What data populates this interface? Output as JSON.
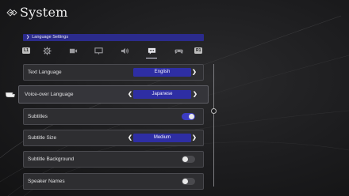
{
  "header": {
    "title": "System"
  },
  "section": {
    "label": "Language Settings"
  },
  "tabs": {
    "left_badge": "L1",
    "right_badge": "R1",
    "items": [
      {
        "icon": "gear-icon"
      },
      {
        "icon": "video-icon"
      },
      {
        "icon": "display-icon"
      },
      {
        "icon": "speaker-icon"
      },
      {
        "icon": "speech-bubble-icon",
        "active": true
      },
      {
        "icon": "gamepad-icon"
      }
    ]
  },
  "settings": {
    "text_language": {
      "label": "Text Language",
      "value": "English"
    },
    "voice_language": {
      "label": "Voice-over Language",
      "value": "Japanese"
    },
    "subtitles": {
      "label": "Subtitles",
      "state": "on"
    },
    "subtitle_size": {
      "label": "Subtitle Size",
      "value": "Medium"
    },
    "subtitle_background": {
      "label": "Subtitle Background",
      "state": "off"
    },
    "speaker_names": {
      "label": "Speaker Names",
      "state": "off"
    }
  },
  "arrows": {
    "left": "❮",
    "right": "❯"
  },
  "colors": {
    "accent": "#2e2ea4",
    "section_bar": "#2b2b8c",
    "background": "#1c1c1e"
  }
}
